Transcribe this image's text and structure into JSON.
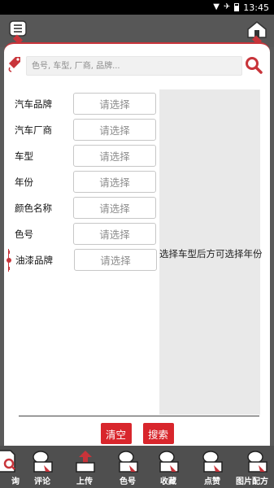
{
  "status_bar": {
    "time": "13:45"
  },
  "search": {
    "placeholder": "色号, 车型, 厂商, 品牌..."
  },
  "form": {
    "rows": [
      {
        "label": "汽车品牌",
        "value": "请选择"
      },
      {
        "label": "汽车厂商",
        "value": "请选择"
      },
      {
        "label": "车型",
        "value": "请选择"
      },
      {
        "label": "年份",
        "value": "请选择"
      },
      {
        "label": "颜色名称",
        "value": "请选择"
      },
      {
        "label": "色号",
        "value": "请选择"
      },
      {
        "label": "油漆品牌",
        "value": "请选择"
      }
    ],
    "side_note": "选择车型后方可选择年份"
  },
  "actions": {
    "clear": "清空",
    "search": "搜索"
  },
  "nav": [
    {
      "label": "询",
      "icon": "search-doc-icon"
    },
    {
      "label": "评论",
      "icon": "comment-icon"
    },
    {
      "label": "上传",
      "icon": "upload-icon"
    },
    {
      "label": "色号",
      "icon": "color-code-icon"
    },
    {
      "label": "收藏",
      "icon": "favorite-icon"
    },
    {
      "label": "点赞",
      "icon": "like-icon"
    },
    {
      "label": "图片配方",
      "icon": "image-formula-icon"
    }
  ],
  "colors": {
    "accent": "#d8262c",
    "dark": "#555555"
  }
}
